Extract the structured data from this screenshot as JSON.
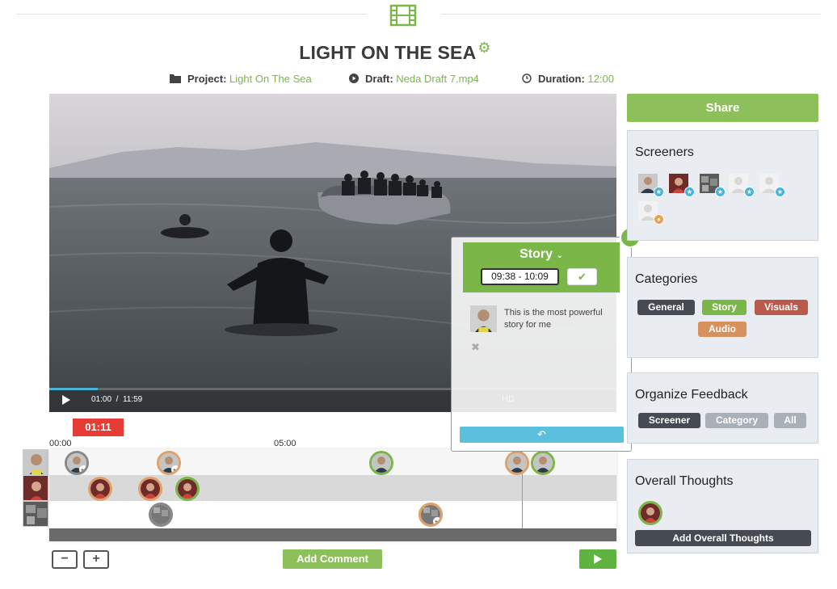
{
  "header": {
    "title": "LIGHT ON THE SEA",
    "project_label": "Project:",
    "project_value": "Light On The Sea",
    "draft_label": "Draft:",
    "draft_value": "Neda Draft 7.mp4",
    "duration_label": "Duration:",
    "duration_value": "12:00"
  },
  "video": {
    "current": "01:00",
    "separator": "/",
    "total": "11:59",
    "hd_label": "HD",
    "progress": 0.085
  },
  "timeline": {
    "current_time": "01:11",
    "ticks": [
      "00:00",
      "05:00"
    ]
  },
  "controls": {
    "zoom_out": "−",
    "zoom_in": "+",
    "add_comment": "Add Comment"
  },
  "popup": {
    "category": "Story",
    "range": "09:38 - 10:09",
    "comment": "This is the most powerful story for me",
    "close": "×"
  },
  "sidebar": {
    "share": "Share",
    "screeners_title": "Screeners",
    "categories_title": "Categories",
    "categories": [
      {
        "label": "General",
        "color": "#464a52"
      },
      {
        "label": "Story",
        "color": "#7ab648"
      },
      {
        "label": "Visuals",
        "color": "#b95a4c"
      },
      {
        "label": "Audio",
        "color": "#d6915c"
      }
    ],
    "organize_title": "Organize Feedback",
    "organize": [
      {
        "label": "Screener",
        "color": "#464a52"
      },
      {
        "label": "Category",
        "color": "#a9b0b8"
      },
      {
        "label": "All",
        "color": "#a9b0b8"
      }
    ],
    "overall_title": "Overall Thoughts",
    "overall_button": "Add Overall Thoughts"
  },
  "colors": {
    "accent": "#7ab648",
    "danger": "#e53c35",
    "info": "#5bc0de"
  }
}
